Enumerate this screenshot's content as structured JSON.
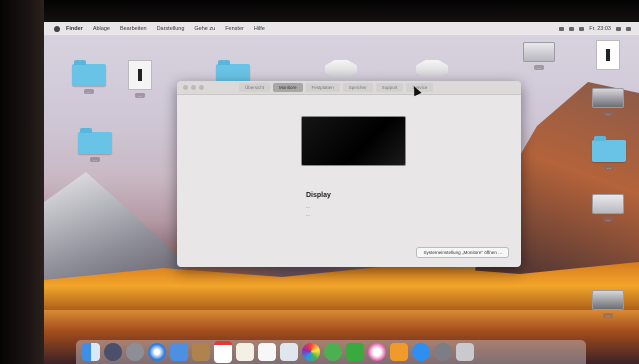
{
  "menubar": {
    "app": "Finder",
    "items": [
      "Ablage",
      "Bearbeiten",
      "Darstellung",
      "Gehe zu",
      "Fenster",
      "Hilfe"
    ],
    "clock": "Fr. 23:03"
  },
  "desktop": {
    "icons": [
      {
        "kind": "folder",
        "label": "..."
      },
      {
        "kind": "document",
        "label": "..."
      },
      {
        "kind": "folder",
        "label": "..."
      },
      {
        "kind": "disc",
        "label": ""
      },
      {
        "kind": "disc",
        "label": ""
      },
      {
        "kind": "folder",
        "label": "..."
      },
      {
        "kind": "drive",
        "label": "..."
      },
      {
        "kind": "document",
        "label": ""
      },
      {
        "kind": "drive",
        "label": "..."
      },
      {
        "kind": "folder",
        "label": "..."
      },
      {
        "kind": "drive",
        "label": "..."
      },
      {
        "kind": "drive",
        "label": "..."
      }
    ]
  },
  "window": {
    "tabs": [
      "Übersicht",
      "Monitore",
      "Festplatten",
      "Speicher",
      "Support",
      "Service"
    ],
    "active_tab": 1,
    "display_title": "Display",
    "lines": [
      "...",
      "..."
    ],
    "sys_button": "Systemeinstellung „Monitore“ öffnen ..."
  },
  "dock": {
    "apps": [
      "finder",
      "launchpad",
      "rocket",
      "safari",
      "mail",
      "contacts",
      "calendar",
      "notes",
      "reminders",
      "preview",
      "photos",
      "messages",
      "facetime",
      "itunes",
      "ibooks",
      "appstore",
      "settings",
      "trash"
    ]
  }
}
